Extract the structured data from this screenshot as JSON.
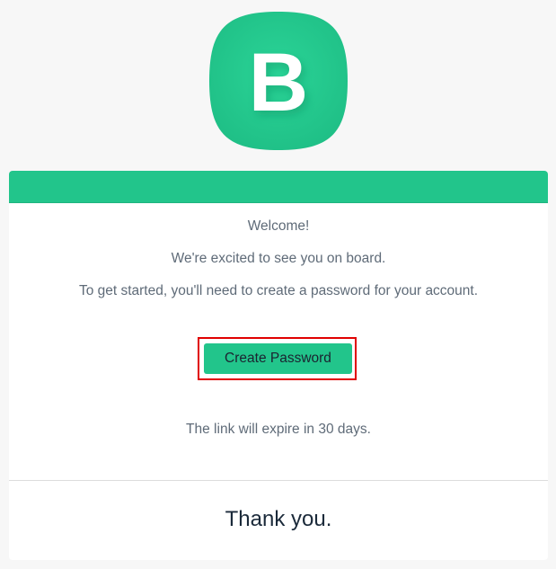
{
  "brand": {
    "logo_letter": "B",
    "accent_color": "#22c58b"
  },
  "email": {
    "welcome": "Welcome!",
    "excited": "We're excited to see you on board.",
    "get_started": "To get started, you'll need to create a password for your account.",
    "create_password_label": "Create Password",
    "expiry_note": "The link will expire in 30 days.",
    "thank_you": "Thank you."
  }
}
